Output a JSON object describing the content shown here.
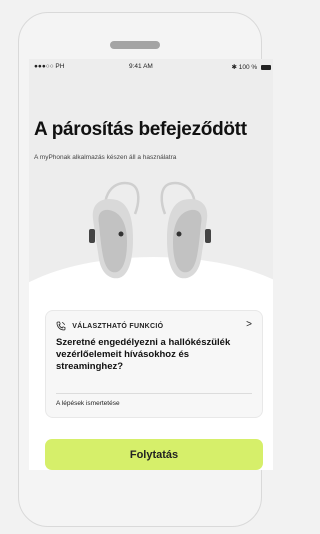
{
  "status_bar": {
    "carrier": "●●●○○ PH",
    "time": "9:41 AM",
    "battery": "100 %"
  },
  "page": {
    "title": "A párosítás befejeződött",
    "subtitle": "A myPhonak alkalmazás készen áll a használatra"
  },
  "feature_card": {
    "heading": "VÁLASZTHATÓ FUNKCIÓ",
    "question": "Szeretné engedélyezni a hallókészülék vezérlőelemeit hívásokhoz és streaminghez?",
    "link": "A lépések ismertetése",
    "icon": "phone-call-icon"
  },
  "actions": {
    "continue_label": "Folytatás"
  },
  "colors": {
    "accent": "#d6ef6a",
    "background": "#ededed",
    "card": "#f7f7f7"
  }
}
